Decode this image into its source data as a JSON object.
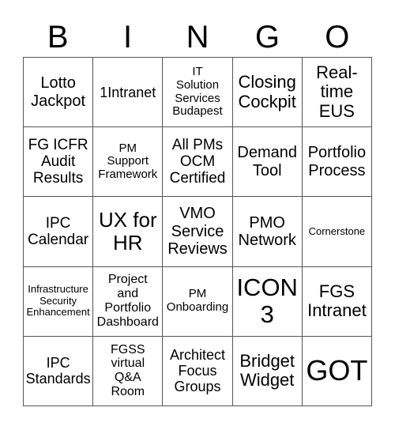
{
  "header": {
    "letters": [
      "B",
      "I",
      "N",
      "G",
      "O"
    ]
  },
  "cells": [
    [
      "Lotto\nJackpot",
      "1Intranet",
      "IT\nSolution\nServices\nBudapest",
      "Closing\nCockpit",
      "Real-\ntime\nEUS"
    ],
    [
      "FG ICFR\nAudit\nResults",
      "PM\nSupport\nFramework",
      "All PMs\nOCM\nCertified",
      "Demand\nTool",
      "Portfolio\nProcess"
    ],
    [
      "IPC\nCalendar",
      "UX for\nHR",
      "VMO\nService\nReviews",
      "PMO\nNetwork",
      "Cornerstone"
    ],
    [
      "Infrastructure\nSecurity\nEnhancement",
      "Project\nand\nPortfolio\nDashboard",
      "PM\nOnboarding",
      "ICON\n3",
      "FGS\nIntranet"
    ],
    [
      "IPC\nStandards",
      "FGSS\nvirtual\nQ&A\nRoom",
      "Architect\nFocus\nGroups",
      "Bridget\nWidget",
      "GOT"
    ]
  ]
}
